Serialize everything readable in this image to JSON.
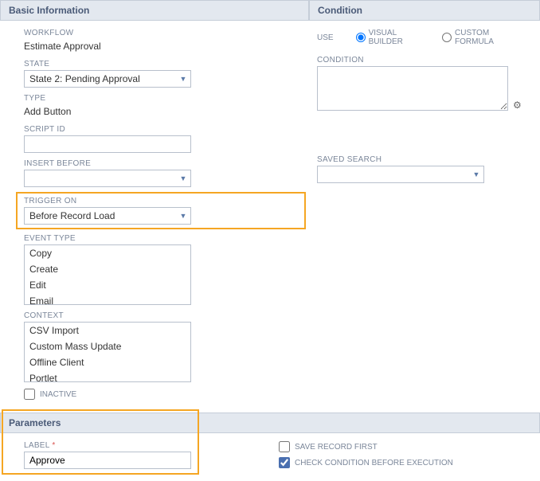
{
  "basicInfo": {
    "header": "Basic Information",
    "workflow": {
      "label": "WORKFLOW",
      "value": "Estimate Approval"
    },
    "state": {
      "label": "STATE",
      "value": "State 2: Pending Approval"
    },
    "type": {
      "label": "TYPE",
      "value": "Add Button"
    },
    "scriptId": {
      "label": "SCRIPT ID",
      "value": ""
    },
    "insertBefore": {
      "label": "INSERT BEFORE",
      "value": ""
    },
    "triggerOn": {
      "label": "TRIGGER ON",
      "value": "Before Record Load"
    },
    "eventType": {
      "label": "EVENT TYPE",
      "options": [
        "Copy",
        "Create",
        "Edit",
        "Email"
      ]
    },
    "context": {
      "label": "CONTEXT",
      "options": [
        "CSV Import",
        "Custom Mass Update",
        "Offline Client",
        "Portlet"
      ]
    },
    "inactive": {
      "label": "INACTIVE",
      "checked": false
    }
  },
  "condition": {
    "header": "Condition",
    "useLabel": "USE",
    "visualBuilder": "VISUAL BUILDER",
    "customFormula": "CUSTOM FORMULA",
    "conditionLabel": "CONDITION",
    "conditionValue": "",
    "savedSearch": {
      "label": "SAVED SEARCH",
      "value": ""
    }
  },
  "parameters": {
    "header": "Parameters",
    "labelField": {
      "label": "LABEL",
      "value": "Approve"
    },
    "saveRecordFirst": {
      "label": "SAVE RECORD FIRST",
      "checked": false
    },
    "checkCondition": {
      "label": "CHECK CONDITION BEFORE EXECUTION",
      "checked": true
    }
  }
}
